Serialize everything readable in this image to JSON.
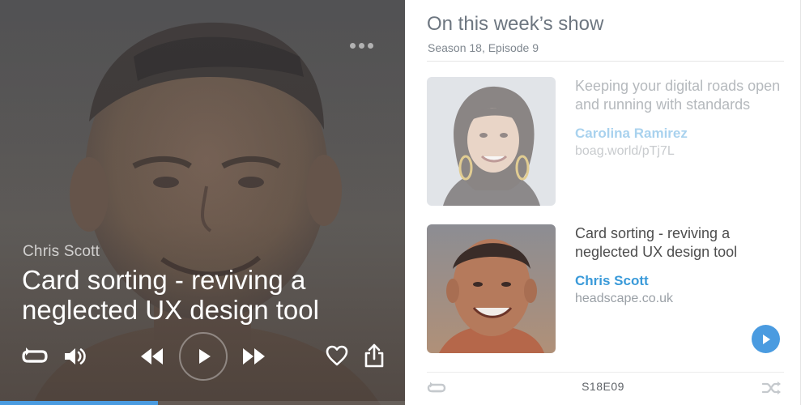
{
  "player": {
    "artist": "Chris Scott",
    "title": "Card sorting - reviving a neglected UX design tool",
    "progress_fraction": 0.39,
    "accent_color": "#4a9be0",
    "icons": [
      "more-icon",
      "repeat-icon",
      "volume-icon",
      "rewind-icon",
      "play-icon",
      "fast-forward-icon",
      "heart-icon",
      "share-icon"
    ]
  },
  "panel": {
    "heading": "On this week’s show",
    "subheading": "Season 18, Episode 9",
    "episodes": [
      {
        "title": "Keeping your digital roads open and running with standards",
        "name": "Carolina Ramirez",
        "link": "boag.world/pTj7L",
        "state": "faded"
      },
      {
        "title": "Card sorting - reviving a neglected UX design tool",
        "name": "Chris Scott",
        "link": "headscape.co.uk",
        "state": "active"
      }
    ],
    "footer_code": "S18E09",
    "icons": [
      "play-icon",
      "repeat-icon",
      "shuffle-icon"
    ]
  }
}
